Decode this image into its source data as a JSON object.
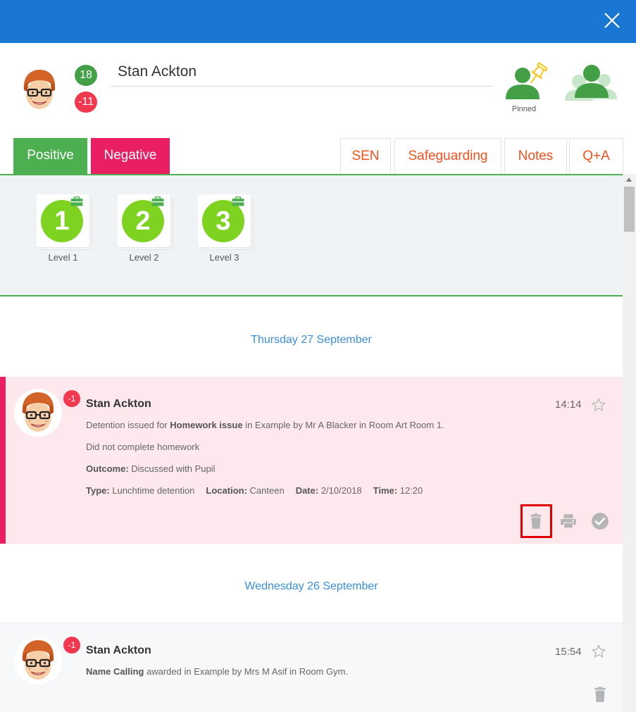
{
  "header": {
    "student_name": "Stan Ackton",
    "positive_points": "18",
    "negative_points": "-11",
    "pinned_label": "Pinned"
  },
  "tabs": [
    {
      "label": "Positive",
      "active": true
    },
    {
      "label": "Negative",
      "active": true
    },
    {
      "label": "SEN"
    },
    {
      "label": "Safeguarding"
    },
    {
      "label": "Notes"
    },
    {
      "label": "Q+A"
    }
  ],
  "levels": [
    {
      "number": "1",
      "label": "Level 1"
    },
    {
      "number": "2",
      "label": "Level 2"
    },
    {
      "number": "3",
      "label": "Level 3"
    }
  ],
  "timeline": [
    {
      "date": "Thursday 27 September",
      "event": {
        "points": "-1",
        "student": "Stan Ackton",
        "time": "14:14",
        "desc_pre": "Detention issued for ",
        "desc_bold": "Homework issue",
        "desc_post": " in Example by Mr A Blacker in Room Art Room 1.",
        "note": "Did not complete homework",
        "outcome_label": "Outcome:",
        "outcome_value": " Discussed with Pupil",
        "type_label": "Type:",
        "type_value": " Lunchtime detention",
        "location_label": "Location:",
        "location_value": " Canteen",
        "date_label": "Date:",
        "date_value": " 2/10/2018",
        "time_label": "Time:",
        "time_value": " 12:20"
      }
    },
    {
      "date": "Wednesday 26 September",
      "event": {
        "points": "-1",
        "student": "Stan Ackton",
        "time": "15:54",
        "desc_bold": "Name Calling",
        "desc_post": " awarded in Example by Mrs M Asif in Room Gym."
      }
    }
  ],
  "icons": {
    "close": "close-icon",
    "pin": "pin-icon",
    "group": "group-icon",
    "star": "star-icon",
    "delete": "trash-icon",
    "print": "print-icon",
    "resolve": "check-circle-icon"
  },
  "colors": {
    "topbar": "#1976d2",
    "positive": "#4caf50",
    "negative": "#e91e63",
    "tab_text": "#f4511e",
    "level": "#7ed321",
    "date_link": "#3a8edc",
    "highlight": "#e00000"
  }
}
